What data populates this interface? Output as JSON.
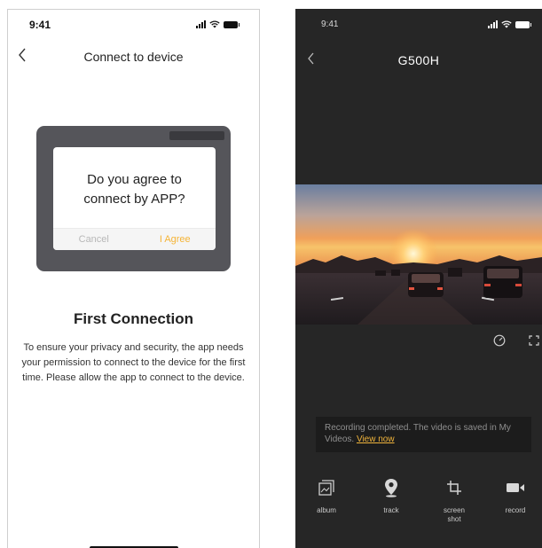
{
  "left_screen": {
    "status_bar": {
      "time": "9:41"
    },
    "nav": {
      "title": "Connect to device"
    },
    "dialog": {
      "message": "Do you agree to connect by APP?",
      "cancel_label": "Cancel",
      "agree_label": "I Agree"
    },
    "heading": "First Connection",
    "description": "To ensure your privacy and security, the app needs your permission to connect to the device for the first time. Please allow the app to connect to the device."
  },
  "right_screen": {
    "status_bar": {
      "time": "9:41"
    },
    "nav": {
      "title": "G500H"
    },
    "toast": {
      "message": "Recording completed. The video is saved in My Videos.",
      "link": "View now"
    },
    "actions": [
      {
        "label": "album",
        "icon": "album-icon"
      },
      {
        "label": "track",
        "icon": "location-pin-icon"
      },
      {
        "label": "screen shot",
        "icon": "crop-icon"
      },
      {
        "label": "record",
        "icon": "video-camera-icon"
      }
    ]
  },
  "colors": {
    "accent": "#f5b436",
    "dark_background": "#262626",
    "device_frame": "#55555a"
  }
}
